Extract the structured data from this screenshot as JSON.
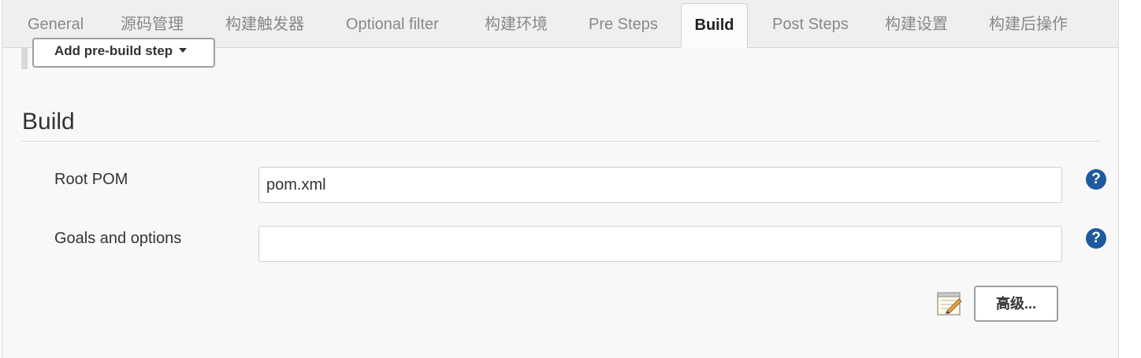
{
  "tabs": [
    {
      "label": "General"
    },
    {
      "label": "源码管理"
    },
    {
      "label": "构建触发器"
    },
    {
      "label": "Optional filter"
    },
    {
      "label": "构建环境"
    },
    {
      "label": "Pre Steps"
    },
    {
      "label": "Build",
      "active": true
    },
    {
      "label": "Post Steps"
    },
    {
      "label": "构建设置"
    },
    {
      "label": "构建后操作"
    }
  ],
  "pre_steps": {
    "add_button_label": "Add pre-build step"
  },
  "build": {
    "title": "Build",
    "root_pom": {
      "label": "Root POM",
      "value": "pom.xml",
      "help": "?"
    },
    "goals": {
      "label": "Goals and options",
      "value": "",
      "help": "?"
    },
    "advanced_label": "高级...",
    "notepad_icon": "notepad-icon"
  },
  "colors": {
    "help_icon": "#1d5aa0",
    "panel_bg": "#f8f8f8",
    "tabbar_bg": "#efefef"
  }
}
